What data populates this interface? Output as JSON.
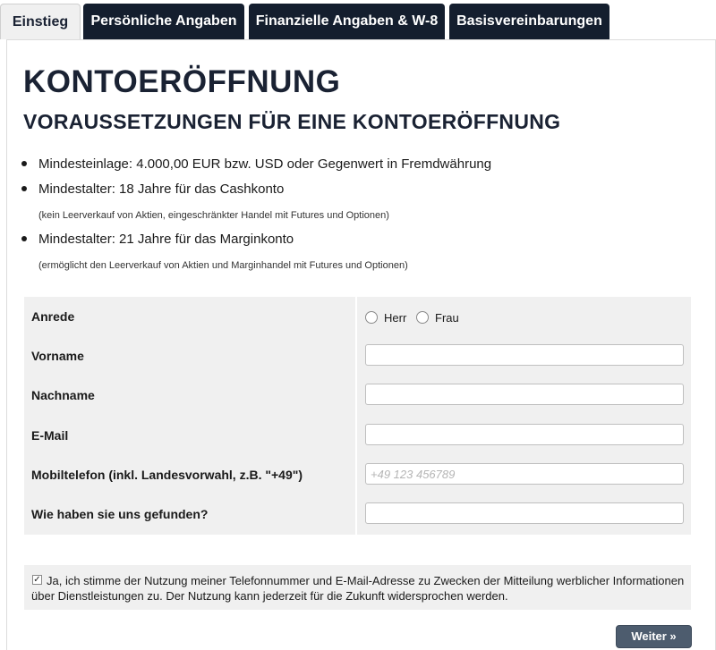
{
  "tabs": [
    {
      "label": "Einstieg",
      "active": true
    },
    {
      "label": "Persönliche Angaben",
      "active": false
    },
    {
      "label": "Finanzielle Angaben & W-8",
      "active": false
    },
    {
      "label": "Basisvereinbarungen",
      "active": false
    }
  ],
  "page": {
    "title": "KONTOERÖFFNUNG",
    "subtitle": "VORAUSSETZUNGEN FÜR EINE KONTOERÖFFNUNG"
  },
  "requirements": [
    {
      "text": "Mindesteinlage: 4.000,00 EUR bzw. USD oder Gegenwert in Fremdwährung",
      "note": ""
    },
    {
      "text": "Mindestalter: 18 Jahre für das Cashkonto",
      "note": "(kein Leerverkauf von Aktien, eingeschränkter Handel mit Futures und Optionen)"
    },
    {
      "text": "Mindestalter: 21 Jahre für das Marginkonto",
      "note": "(ermöglicht den Leerverkauf von Aktien und Marginhandel mit Futures und Optionen)"
    }
  ],
  "form": {
    "salutation": {
      "label": "Anrede",
      "options": [
        "Herr",
        "Frau"
      ]
    },
    "first_name": {
      "label": "Vorname",
      "value": "",
      "placeholder": ""
    },
    "last_name": {
      "label": "Nachname",
      "value": "",
      "placeholder": ""
    },
    "email": {
      "label": "E-Mail",
      "value": "",
      "placeholder": ""
    },
    "mobile": {
      "label": "Mobiltelefon (inkl. Landesvorwahl, z.B. \"+49\")",
      "value": "",
      "placeholder": "+49 123 456789"
    },
    "referral": {
      "label": "Wie haben sie uns gefunden?",
      "value": "",
      "placeholder": ""
    }
  },
  "consent": {
    "checked": true,
    "check_mark": "✓",
    "text": "Ja, ich stimme der Nutzung meiner Telefonnummer und E-Mail-Adresse zu Zwecken der Mitteilung werblicher Informationen über Dienstleistungen zu. Der Nutzung kann jederzeit für die Zukunft widersprochen werden."
  },
  "actions": {
    "next_label": "Weiter »"
  }
}
